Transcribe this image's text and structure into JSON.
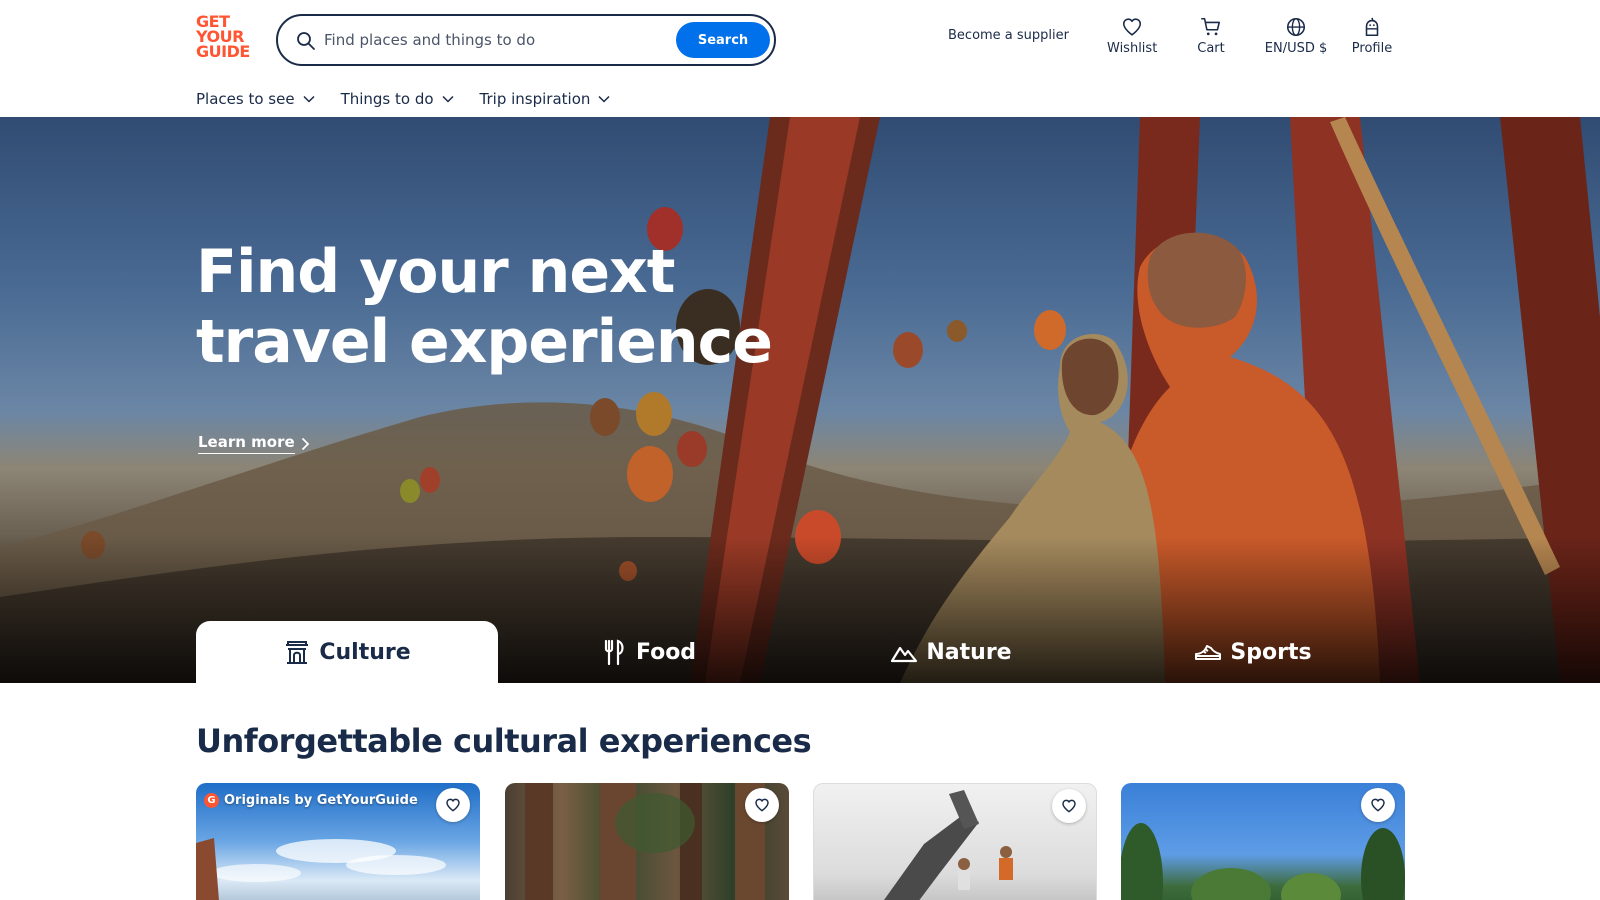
{
  "brand": {
    "logo_lines": [
      "GET",
      "YOUR",
      "GUIDE"
    ],
    "accent": "#ff5533",
    "primary": "#0071eb",
    "text": "#1a2b49"
  },
  "search": {
    "placeholder": "Find places and things to do",
    "value": "",
    "button_label": "Search",
    "icon": "search-icon"
  },
  "header": {
    "supplier_link": "Become a supplier",
    "actions": [
      {
        "label": "Wishlist",
        "icon": "heart-icon"
      },
      {
        "label": "Cart",
        "icon": "cart-icon"
      },
      {
        "label": "EN/USD $",
        "icon": "globe-icon"
      },
      {
        "label": "Profile",
        "icon": "profile-icon"
      }
    ]
  },
  "nav": {
    "items": [
      {
        "label": "Places to see",
        "icon": "chevron-down-icon"
      },
      {
        "label": "Things to do",
        "icon": "chevron-down-icon"
      },
      {
        "label": "Trip inspiration",
        "icon": "chevron-down-icon"
      }
    ]
  },
  "hero": {
    "title": "Find your next travel experience",
    "learn_more": "Learn more",
    "tabs": [
      {
        "label": "Culture",
        "icon": "landmark-icon",
        "active": true
      },
      {
        "label": "Food",
        "icon": "fork-knife-icon",
        "active": false
      },
      {
        "label": "Nature",
        "icon": "mountain-icon",
        "active": false
      },
      {
        "label": "Sports",
        "icon": "sneaker-icon",
        "active": false
      }
    ]
  },
  "section": {
    "title": "Unforgettable cultural experiences",
    "cards": [
      {
        "badge": "Originals by GetYourGuide",
        "badge_icon": "G",
        "wishlist_icon": "heart-icon"
      },
      {
        "badge": "",
        "wishlist_icon": "heart-icon"
      },
      {
        "badge": "",
        "wishlist_icon": "heart-icon"
      },
      {
        "badge": "",
        "wishlist_icon": "heart-icon"
      }
    ]
  }
}
